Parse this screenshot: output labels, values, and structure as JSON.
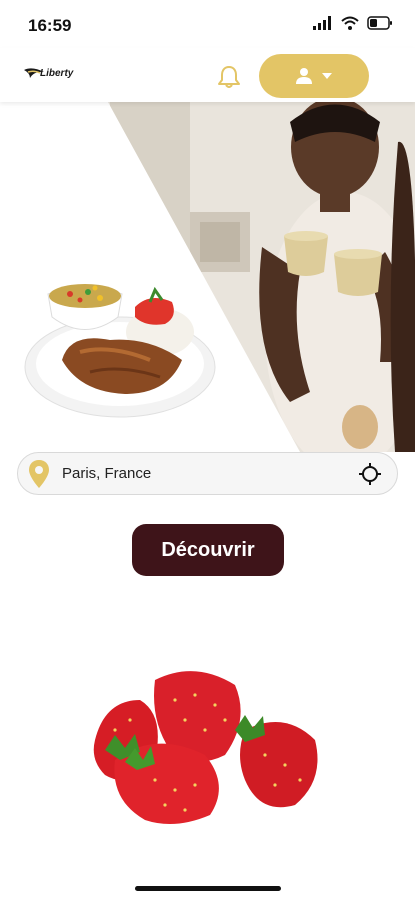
{
  "status_bar": {
    "time": "16:59"
  },
  "header": {
    "logo_text": "Liberty",
    "accent_color": "#e3c566",
    "icons": [
      "bell-icon",
      "user-icon",
      "caret-down-icon"
    ]
  },
  "search": {
    "location": "Paris, France"
  },
  "cta": {
    "label": "Découvrir",
    "color": "#3e1419"
  }
}
